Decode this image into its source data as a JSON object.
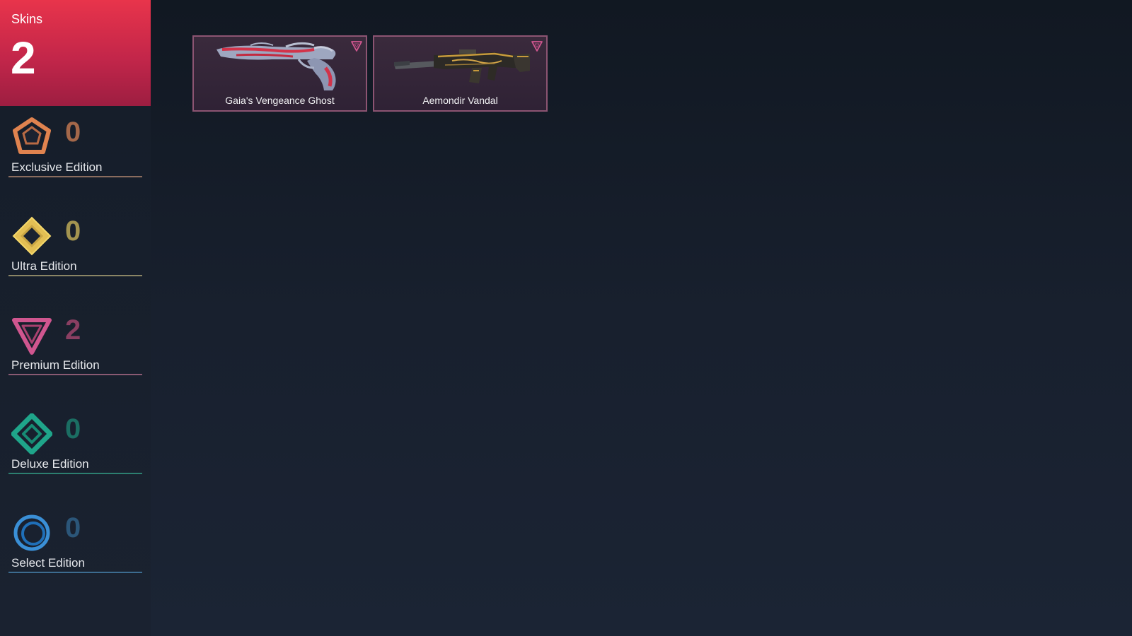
{
  "sidebar": {
    "total": {
      "label": "Skins",
      "count": "2"
    },
    "tiers": [
      {
        "label": "Exclusive Edition",
        "count": "0",
        "icon": "exclusive-edition-icon",
        "color": "#e0834f",
        "count_color": "#a4684a",
        "line_color": "#8a6c5e"
      },
      {
        "label": "Ultra Edition",
        "count": "0",
        "icon": "ultra-edition-icon",
        "color": "#f2cf62",
        "count_color": "#a39450",
        "line_color": "#8b8565"
      },
      {
        "label": "Premium Edition",
        "count": "2",
        "icon": "premium-edition-icon",
        "color": "#d0568f",
        "count_color": "#8a3f62",
        "line_color": "#8a5a73"
      },
      {
        "label": "Deluxe Edition",
        "count": "0",
        "icon": "deluxe-edition-icon",
        "color": "#1fa58a",
        "count_color": "#1b6e63",
        "line_color": "#2c7f70"
      },
      {
        "label": "Select Edition",
        "count": "0",
        "icon": "select-edition-icon",
        "color": "#3a8fd6",
        "count_color": "#2b5679",
        "line_color": "#3c6c90"
      }
    ]
  },
  "skins": [
    {
      "name": "Gaia's Vengeance Ghost",
      "tier_icon": "premium-edition-icon",
      "weapon": "ghost-pistol"
    },
    {
      "name": "Aemondir Vandal",
      "tier_icon": "premium-edition-icon",
      "weapon": "vandal-rifle"
    }
  ],
  "colors": {
    "accent": "#e8344b",
    "card_border": "#8c5472",
    "background": "#161e2b"
  }
}
